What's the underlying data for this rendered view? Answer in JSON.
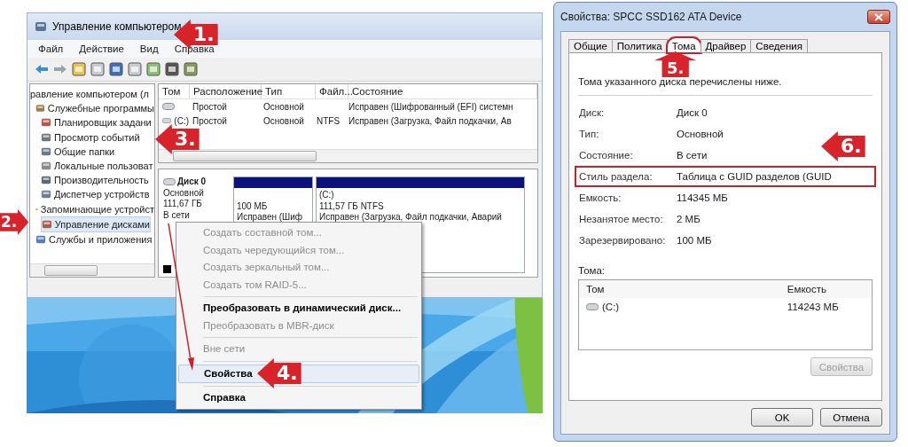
{
  "management_window": {
    "title": "Управление компьютером",
    "menu": [
      "Файл",
      "Действие",
      "Вид",
      "Справка"
    ],
    "tree": [
      {
        "label": "равление компьютером (л",
        "selected": false,
        "children": [
          {
            "label": "Служебные программы",
            "selected": false,
            "children": [
              {
                "label": "Планировщик задани",
                "selected": false
              },
              {
                "label": "Просмотр событий",
                "selected": false
              },
              {
                "label": "Общие папки",
                "selected": false
              },
              {
                "label": "Локальные пользоват",
                "selected": false
              },
              {
                "label": "Производительность",
                "selected": false
              },
              {
                "label": "Диспетчер устройств",
                "selected": false
              }
            ]
          },
          {
            "label": "Запоминающие устройст",
            "selected": false,
            "children": [
              {
                "label": "Управление дисками",
                "selected": true
              }
            ]
          },
          {
            "label": "Службы и приложения",
            "selected": false
          }
        ]
      }
    ],
    "volume_table": {
      "columns": [
        "Том",
        "Расположение",
        "Тип",
        "Файл...",
        "Состояние"
      ],
      "rows": [
        {
          "layout": "Простой",
          "type": "Основной",
          "status": "Исправен (Шифрованный (EFI) системн"
        },
        {
          "volume": "(C:)",
          "layout": "Простой",
          "type": "Основной",
          "fs": "NTFS",
          "status": "Исправен (Загрузка, Файл подкачки, Ав"
        }
      ]
    },
    "disk": {
      "name": "Диск 0",
      "type": "Основной",
      "size": "111,67 ГБ",
      "status": "В сети",
      "partitions": [
        {
          "size": "100 МБ",
          "status": "Исправен (Шиф"
        },
        {
          "label": "(C:)",
          "size": "111,57 ГБ NTFS",
          "status": "Исправен (Загрузка, Файл подкачки, Аварий"
        }
      ]
    }
  },
  "context_menu": [
    {
      "kind": "item",
      "label": "Создать составной том...",
      "disabled": true,
      "selected": false
    },
    {
      "kind": "item",
      "label": "Создать чередующийся том...",
      "disabled": true,
      "selected": false
    },
    {
      "kind": "item",
      "label": "Создать зеркальный том...",
      "disabled": true,
      "selected": false
    },
    {
      "kind": "item",
      "label": "Создать том RAID-5...",
      "disabled": true,
      "selected": false
    },
    {
      "kind": "separator"
    },
    {
      "kind": "item",
      "label": "Преобразовать в динамический диск...",
      "disabled": false,
      "selected": false
    },
    {
      "kind": "item",
      "label": "Преобразовать в MBR-диск",
      "disabled": true,
      "selected": false
    },
    {
      "kind": "separator"
    },
    {
      "kind": "item",
      "label": "Вне сети",
      "disabled": true,
      "selected": false
    },
    {
      "kind": "separator"
    },
    {
      "kind": "item",
      "label": "Свойства",
      "disabled": false,
      "selected": true
    },
    {
      "kind": "separator"
    },
    {
      "kind": "item",
      "label": "Справка",
      "disabled": false,
      "selected": false
    }
  ],
  "properties_dialog": {
    "title": "Свойства: SPCC SSD162 ATA Device",
    "tabs": [
      {
        "label": "Общие",
        "selected": false,
        "circled": false
      },
      {
        "label": "Политика",
        "selected": false,
        "circled": false
      },
      {
        "label": "Тома",
        "selected": true,
        "circled": true
      },
      {
        "label": "Драйвер",
        "selected": false,
        "circled": false
      },
      {
        "label": "Сведения",
        "selected": false,
        "circled": false
      }
    ],
    "intro": "Тома указанного диска перечислены ниже.",
    "fields": [
      {
        "label": "Диск:",
        "value": "Диск 0",
        "highlighted": false
      },
      {
        "label": "Тип:",
        "value": "Основной",
        "highlighted": false
      },
      {
        "label": "Состояние:",
        "value": "В сети",
        "highlighted": false
      },
      {
        "label": "Стиль раздела:",
        "value": "Таблица с GUID разделов (GUID",
        "highlighted": true
      },
      {
        "label": "Емкость:",
        "value": "114345 МБ",
        "highlighted": false
      },
      {
        "label": "Незанятое место:",
        "value": "2 МБ",
        "highlighted": false
      },
      {
        "label": "Зарезервировано:",
        "value": "100 МБ",
        "highlighted": false
      }
    ],
    "volumes_label": "Тома:",
    "volumes_table": {
      "columns": [
        "Том",
        "Емкость"
      ],
      "rows": [
        {
          "name": "(C:)",
          "capacity": "114243 МБ"
        }
      ]
    },
    "volume_button": {
      "label": "Свойства",
      "disabled": true
    },
    "buttons": [
      "OK",
      "Отмена"
    ]
  },
  "callouts": [
    {
      "label": "1."
    },
    {
      "label": "2."
    },
    {
      "label": "3."
    },
    {
      "label": "4."
    },
    {
      "label": "5."
    },
    {
      "label": "6."
    }
  ]
}
